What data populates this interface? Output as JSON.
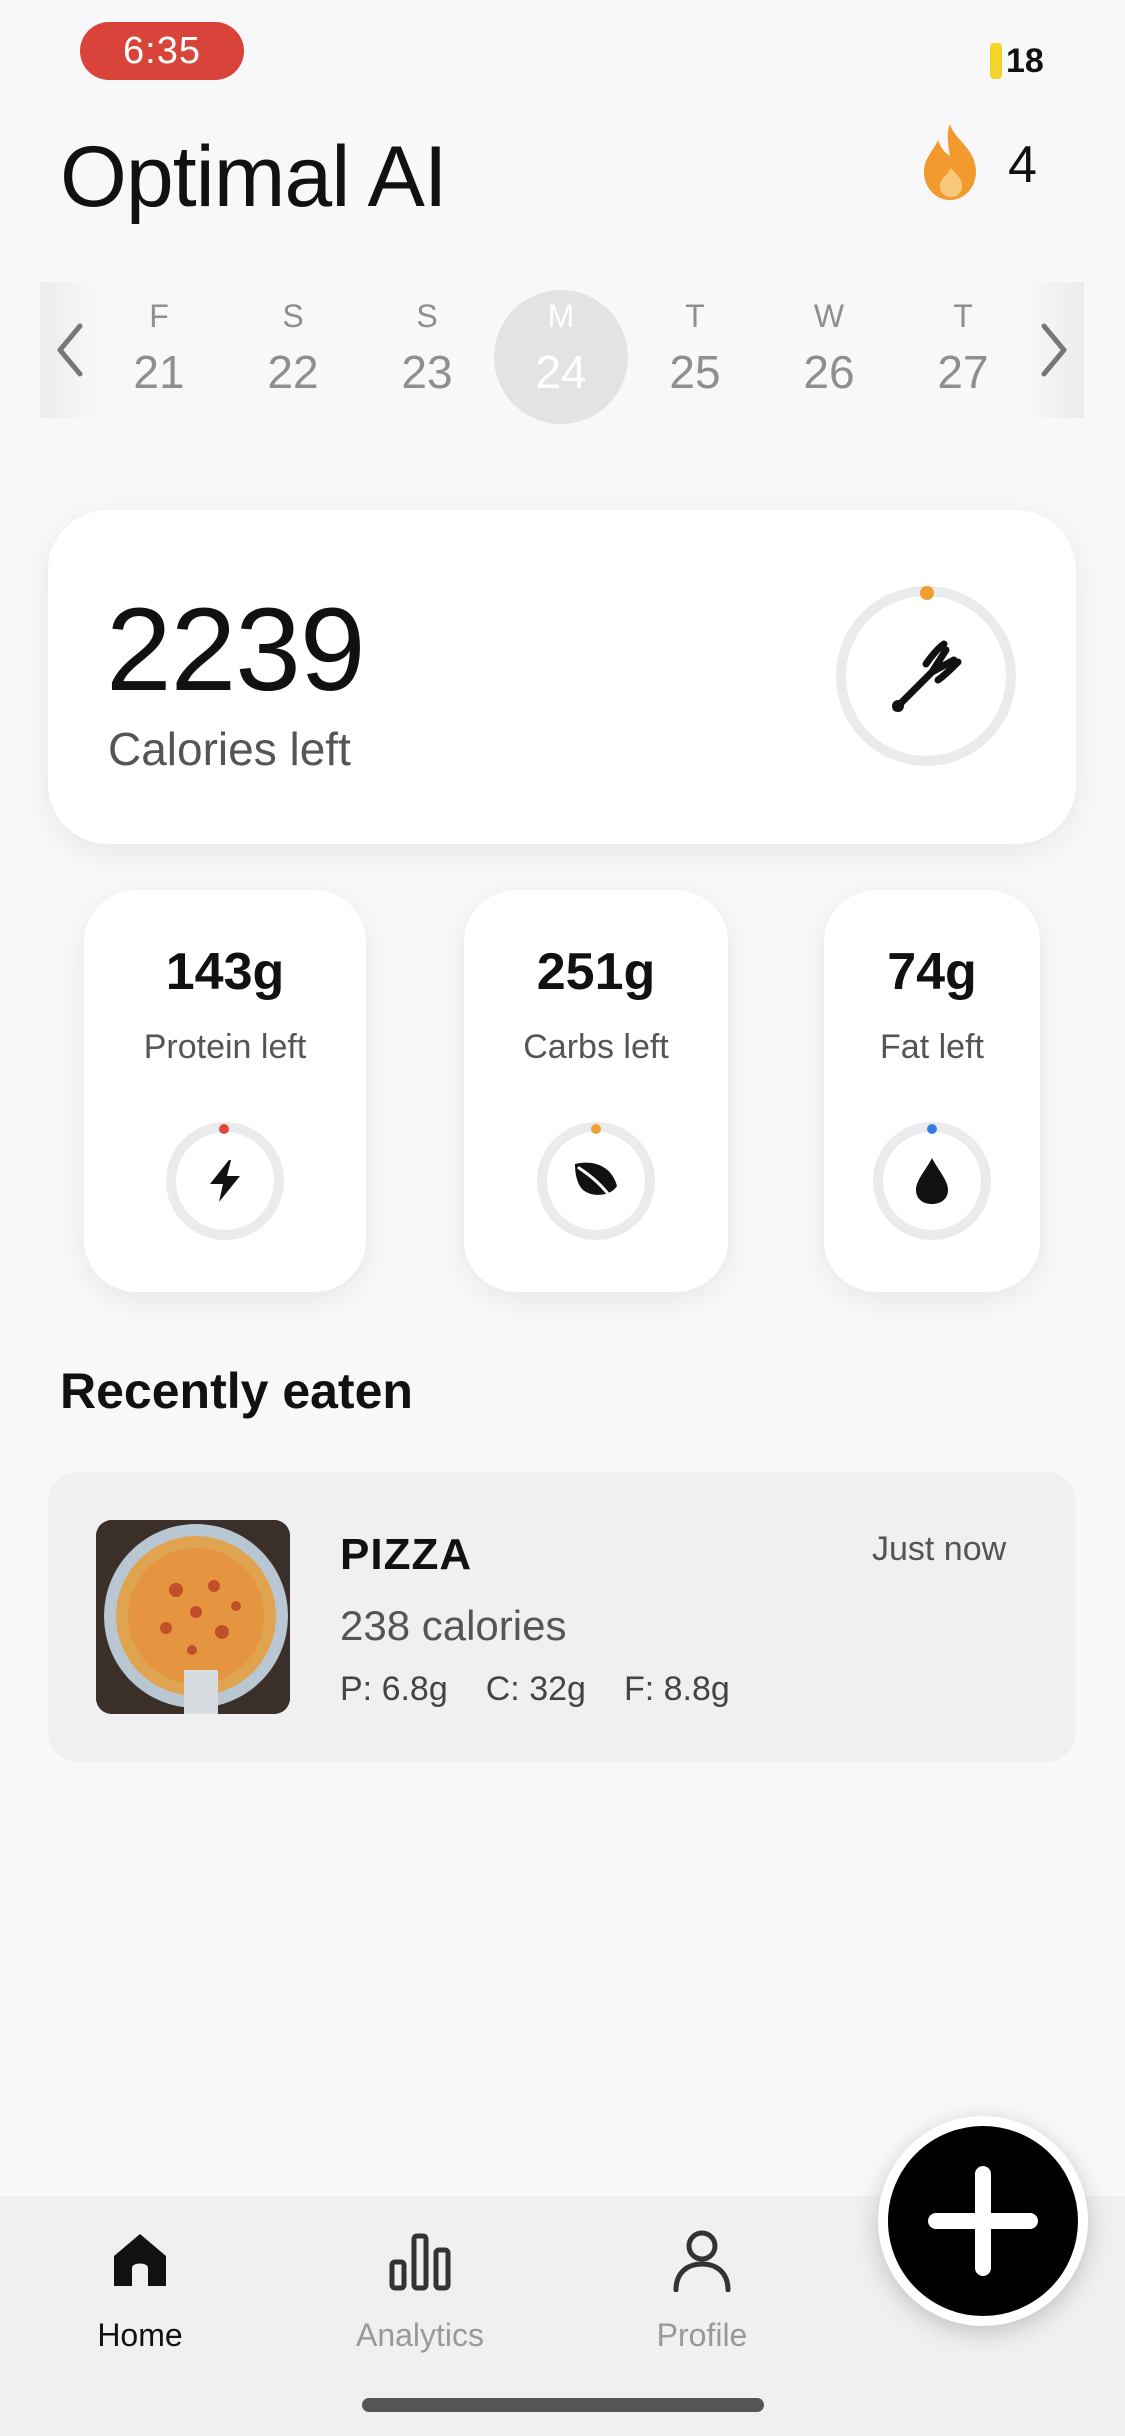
{
  "status_bar": {
    "time": "6:35",
    "battery": "18"
  },
  "header": {
    "title": "Optimal AI",
    "streak_count": "4"
  },
  "date_strip": {
    "days": [
      {
        "letter": "F",
        "num": "21"
      },
      {
        "letter": "S",
        "num": "22"
      },
      {
        "letter": "S",
        "num": "23"
      },
      {
        "letter": "M",
        "num": "24"
      },
      {
        "letter": "T",
        "num": "25"
      },
      {
        "letter": "W",
        "num": "26"
      },
      {
        "letter": "T",
        "num": "27"
      }
    ],
    "selected_index": 3
  },
  "calories": {
    "value": "2239",
    "label": "Calories left",
    "icon": "fork-icon",
    "accent": "#f0a030"
  },
  "macros": [
    {
      "value": "143g",
      "label": "Protein left",
      "icon": "bolt-icon",
      "accent": "#e04a3a"
    },
    {
      "value": "251g",
      "label": "Carbs left",
      "icon": "leaf-icon",
      "accent": "#f0a030"
    },
    {
      "value": "74g",
      "label": "Fat left",
      "icon": "drop-icon",
      "accent": "#3a7be0"
    }
  ],
  "recent": {
    "title": "Recently eaten",
    "items": [
      {
        "name": "PIZZA",
        "calories": "238 calories",
        "protein": "P: 6.8g",
        "carbs": "C: 32g",
        "fat": "F: 8.8g",
        "time": "Just now"
      }
    ]
  },
  "nav": {
    "items": [
      {
        "label": "Home",
        "icon": "home-icon"
      },
      {
        "label": "Analytics",
        "icon": "bar-chart-icon"
      },
      {
        "label": "Profile",
        "icon": "person-icon"
      }
    ]
  },
  "colors": {
    "streak": "#f29a2e",
    "time_pill": "#d9443a"
  }
}
